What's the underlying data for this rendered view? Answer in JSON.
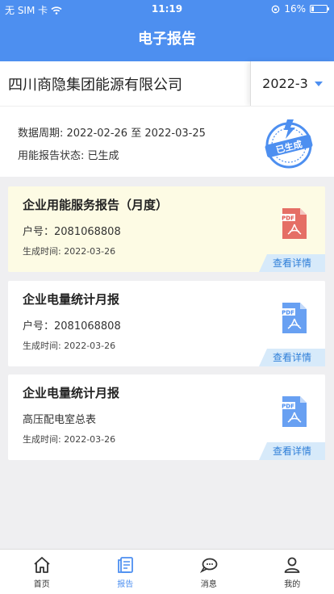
{
  "status_bar": {
    "carrier": "无 SIM 卡",
    "time": "11:19",
    "battery_text": "16%",
    "battery_level": 0.16
  },
  "navbar": {
    "title": "电子报告"
  },
  "company": {
    "name": "四川商隐集团能源有限公司",
    "period": "2022-3"
  },
  "summary": {
    "period_label": "数据周期: 2022-02-26 至 2022-03-25",
    "status_label": "用能报告状态: 已生成",
    "stamp_text": "已生成"
  },
  "reports": [
    {
      "title": "企业用能服务报告（月度）",
      "subtitle": "户号：2081068808",
      "generated": "生成时间: 2022-03-26",
      "detail": "查看详情",
      "icon_color": "#e0554f"
    },
    {
      "title": "企业电量统计月报",
      "subtitle": "户号：2081068808",
      "generated": "生成时间: 2022-03-26",
      "detail": "查看详情",
      "icon_color": "#4d8ff0"
    },
    {
      "title": "企业电量统计月报",
      "subtitle": "高压配电室总表",
      "generated": "生成时间: 2022-03-26",
      "detail": "查看详情",
      "icon_color": "#4d8ff0"
    }
  ],
  "tabs": [
    {
      "label": "首页",
      "icon": "home-icon"
    },
    {
      "label": "报告",
      "icon": "report-icon"
    },
    {
      "label": "消息",
      "icon": "message-icon"
    },
    {
      "label": "我的",
      "icon": "profile-icon"
    }
  ],
  "colors": {
    "primary": "#4d8ff0",
    "highlight": "#fdfbe4",
    "detail_bg": "#d7eafa"
  }
}
